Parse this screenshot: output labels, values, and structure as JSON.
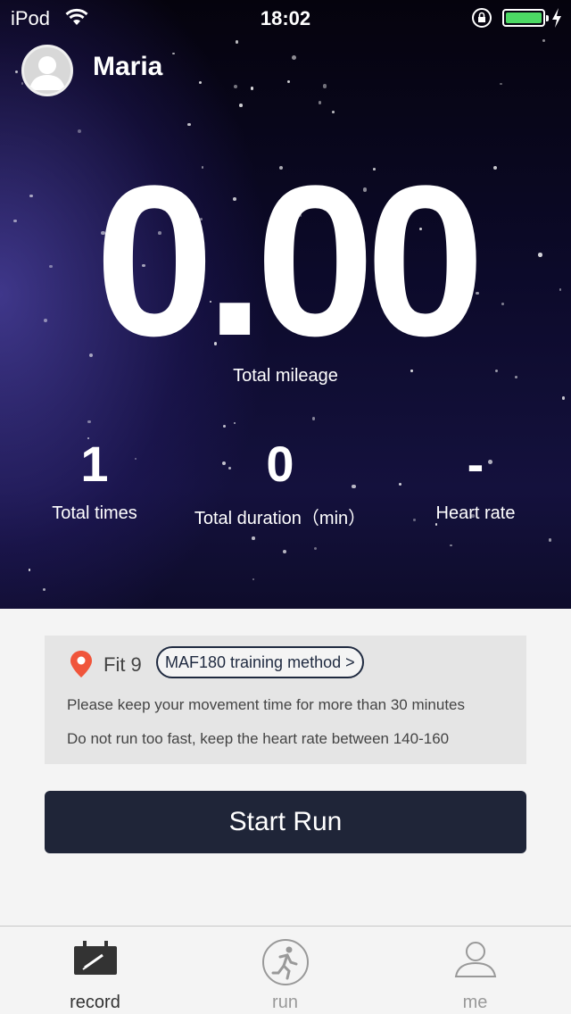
{
  "status_bar": {
    "carrier": "iPod",
    "time": "18:02",
    "battery_level": 1.0,
    "battery_color": "#4cd964"
  },
  "user": {
    "name": "Maria"
  },
  "stats": {
    "total_mileage": "0.00",
    "total_mileage_label": "Total mileage",
    "total_times": "1",
    "total_times_label": "Total times",
    "total_duration": "0",
    "total_duration_label": "Total duration（min）",
    "heart_rate": "-",
    "heart_rate_label": "Heart rate"
  },
  "tip": {
    "icon": "location-pin-icon",
    "title": "Fit 9",
    "method_label": "MAF180 training method >",
    "line1": "Please keep your movement time for more than 30 minutes",
    "line2": "Do not run too fast, keep the heart rate between 140-160"
  },
  "start_button": "Start Run",
  "tabbar": {
    "tabs": [
      {
        "label": "record",
        "icon": "record-icon",
        "active": true
      },
      {
        "label": "run",
        "icon": "run-icon",
        "active": false
      },
      {
        "label": "me",
        "icon": "person-icon",
        "active": false
      }
    ],
    "active_color": "#333333",
    "inactive_color": "#999999"
  }
}
